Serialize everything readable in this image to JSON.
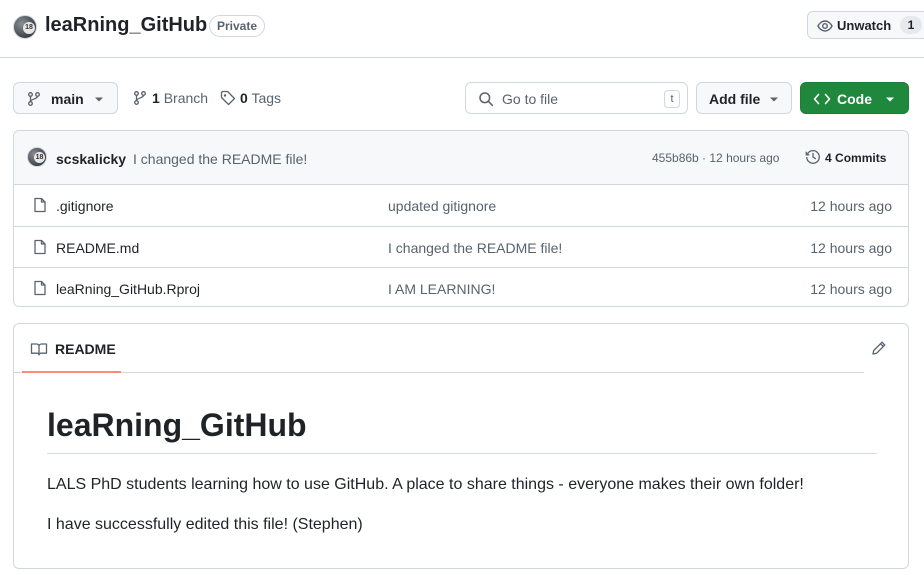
{
  "repo": {
    "name": "leaRning_GitHub",
    "visibility": "Private",
    "avatar_badge": "18",
    "watch_label": "Unwatch",
    "watch_count": "1"
  },
  "toolbar": {
    "branch": "main",
    "branches_count": "1",
    "branches_label": "Branch",
    "tags_count": "0",
    "tags_label": "Tags",
    "search_placeholder": "Go to file",
    "search_shortcut": "t",
    "add_file_label": "Add file",
    "code_label": "Code"
  },
  "latest_commit": {
    "author": "scskalicky",
    "message": "I changed the README file!",
    "meta": "455b86b · 12 hours ago",
    "commits_count": "4",
    "commits_label": "Commits"
  },
  "files": [
    {
      "name": ".gitignore",
      "message": "updated gitignore",
      "age": "12 hours ago"
    },
    {
      "name": "README.md",
      "message": "I changed the README file!",
      "age": "12 hours ago"
    },
    {
      "name": "leaRning_GitHub.Rproj",
      "message": "I AM LEARNING!",
      "age": "12 hours ago"
    }
  ],
  "readme": {
    "tab_label": "README",
    "heading": "leaRning_GitHub",
    "paragraphs": [
      "LALS PhD students learning how to use GitHub. A place to share things - everyone makes their own folder!",
      "I have successfully edited this file! (Stephen)"
    ]
  },
  "icons": {
    "avatar": "user-avatar",
    "watch": "eye-icon",
    "branch": "git-branch-icon",
    "tags": "tag-icon",
    "search": "search-icon",
    "code": "code-icon",
    "history": "history-icon",
    "file": "file-icon",
    "book": "book-icon",
    "edit": "pencil-icon"
  },
  "colors": {
    "primary_button": "#1f883d",
    "border": "#d0d7de",
    "muted_text": "#59636e",
    "tab_underline": "#fd8c73"
  }
}
